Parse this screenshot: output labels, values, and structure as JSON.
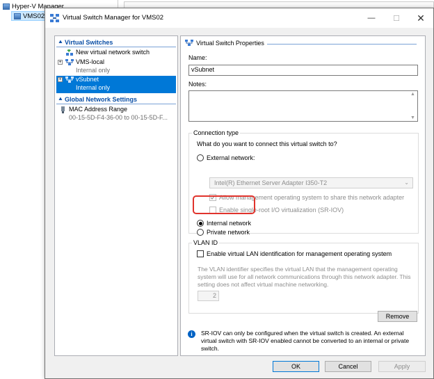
{
  "background": {
    "app_title": "Hyper-V Manager",
    "server_name": "VMS02"
  },
  "dialog": {
    "title": "Virtual Switch Manager for VMS02",
    "window_controls": {
      "minimize": "—",
      "maximize": "☐",
      "close": "✕"
    }
  },
  "tree": {
    "sections": [
      {
        "label": "Virtual Switches",
        "icon": "chevron-up-icon"
      },
      {
        "label": "Global Network Settings",
        "icon": "chevron-up-icon"
      }
    ],
    "items": [
      {
        "label": "New virtual network switch",
        "sub": "",
        "expander": "",
        "icon": "new-switch-icon"
      },
      {
        "label": "VMS-local",
        "sub": "Internal only",
        "expander": "+",
        "icon": "switch-icon"
      },
      {
        "label": "vSubnet",
        "sub": "Internal only",
        "expander": "+",
        "icon": "switch-icon",
        "selected": true
      },
      {
        "label": "MAC Address Range",
        "sub": "00-15-5D-F4-36-00 to 00-15-5D-F...",
        "expander": "",
        "icon": "mac-range-icon"
      }
    ]
  },
  "properties": {
    "header": "Virtual Switch Properties",
    "name_label": "Name:",
    "name_value": "vSubnet",
    "notes_label": "Notes:",
    "notes_value": "",
    "connection_type": {
      "title": "Connection type",
      "question": "What do you want to connect this virtual switch to?",
      "external_label": "External network:",
      "adapter_value": "Intel(R) Ethernet Server Adapter I350-T2",
      "allow_mgmt_label": "Allow management operating system to share this network adapter",
      "sriov_label": "Enable single-root I/O virtualization (SR-IOV)",
      "internal_label": "Internal network",
      "private_label": "Private network",
      "selected": "internal"
    },
    "vlan": {
      "title": "VLAN ID",
      "enable_label": "Enable virtual LAN identification for management operating system",
      "description": "The VLAN identifier specifies the virtual LAN that the management operating system will use for all network communications through this network adapter. This setting does not affect virtual machine networking.",
      "vlan_value": "2"
    },
    "remove_label": "Remove",
    "info_text": "SR-IOV can only be configured when the virtual switch is created. An external virtual switch with SR-IOV enabled cannot be converted to an internal or private switch."
  },
  "buttons": {
    "ok": "OK",
    "cancel": "Cancel",
    "apply": "Apply"
  },
  "colors": {
    "selection": "#0078d7",
    "section_header": "#0a4ea5",
    "highlight_box": "#e0332c",
    "info_icon": "#0062c4"
  }
}
